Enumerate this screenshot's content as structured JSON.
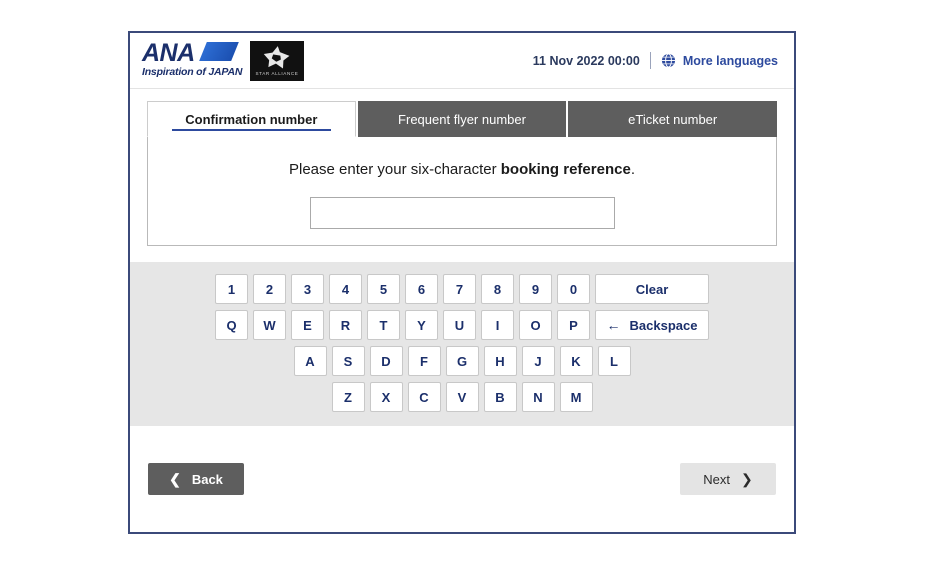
{
  "header": {
    "ana_logo": {
      "wordmark": "ANA",
      "tagline": "Inspiration of JAPAN",
      "icon": "ana-swoosh-icon"
    },
    "star_alliance": {
      "label": "STAR ALLIANCE",
      "icon": "star-alliance-logo"
    },
    "datetime": "11 Nov 2022 00:00",
    "language_link": {
      "label": "More languages",
      "icon": "globe-icon"
    }
  },
  "tabs": [
    {
      "label": "Confirmation number",
      "active": true
    },
    {
      "label": "Frequent flyer number",
      "active": false
    },
    {
      "label": "eTicket number",
      "active": false
    }
  ],
  "panel": {
    "instruction_prefix": "Please enter your six-character ",
    "instruction_bold": "booking reference",
    "instruction_suffix": ".",
    "input_value": "",
    "input_placeholder": ""
  },
  "keyboard": {
    "row_numbers": [
      "1",
      "2",
      "3",
      "4",
      "5",
      "6",
      "7",
      "8",
      "9",
      "0"
    ],
    "clear_label": "Clear",
    "row_qwerty": [
      "Q",
      "W",
      "E",
      "R",
      "T",
      "Y",
      "U",
      "I",
      "O",
      "P"
    ],
    "backspace_label": "Backspace",
    "backspace_icon": "arrow-left-icon",
    "row_asdf": [
      "A",
      "S",
      "D",
      "F",
      "G",
      "H",
      "J",
      "K",
      "L"
    ],
    "row_zxcv": [
      "Z",
      "X",
      "C",
      "V",
      "B",
      "N",
      "M"
    ]
  },
  "footer": {
    "back_label": "Back",
    "back_icon": "chevron-left-icon",
    "next_label": "Next",
    "next_icon": "chevron-right-icon"
  },
  "colors": {
    "frame_border": "#3b4a7a",
    "tab_inactive_bg": "#5e5e5e",
    "accent_blue": "#2d4a9e",
    "key_text": "#1b2f6b",
    "keyboard_bg": "#e6e6e6",
    "next_bg": "#e4e4e4"
  }
}
